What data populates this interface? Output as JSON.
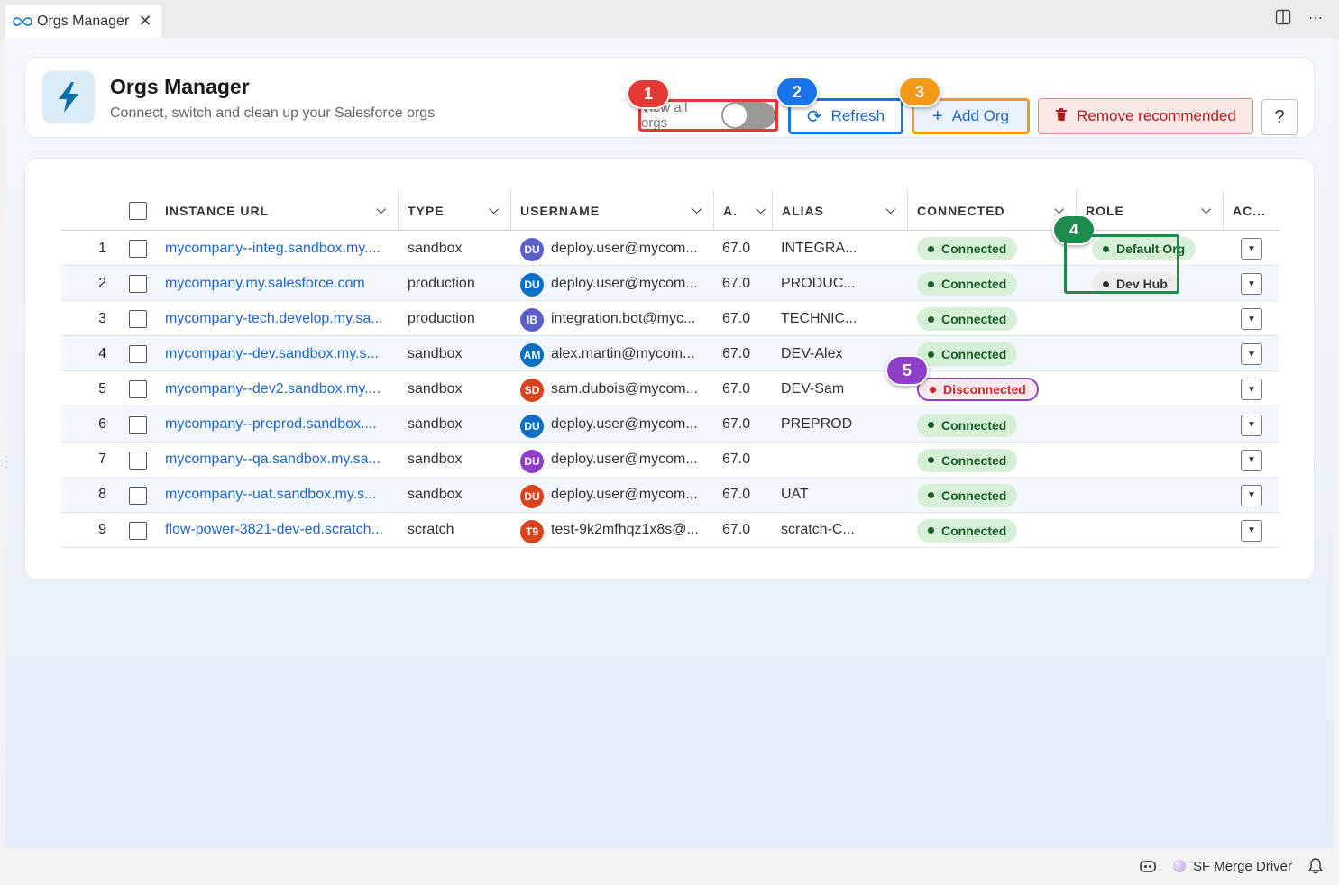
{
  "tab": {
    "title": "Orgs Manager"
  },
  "header": {
    "title": "Orgs Manager",
    "subtitle": "Connect, switch and clean up your Salesforce orgs",
    "toggle_label": "View all orgs",
    "toggle_on": false,
    "refresh_label": "Refresh",
    "add_label": "Add Org",
    "remove_label": "Remove recommended",
    "help_label": "?"
  },
  "badges": [
    "1",
    "2",
    "3",
    "4",
    "5"
  ],
  "columns": [
    "INSTANCE URL",
    "TYPE",
    "USERNAME",
    "A.",
    "ALIAS",
    "CONNECTED",
    "ROLE",
    "AC..."
  ],
  "rows": [
    {
      "num": "1",
      "url": "mycompany--integ.sandbox.my....",
      "type": "sandbox",
      "initials": "DU",
      "avatar_color": "#5b5fc7",
      "user": "deploy.user@mycom...",
      "api": "67.0",
      "alias": "INTEGRA...",
      "connected": "Connected",
      "role": "Default Org"
    },
    {
      "num": "2",
      "url": "mycompany.my.salesforce.com",
      "type": "production",
      "initials": "DU",
      "avatar_color": "#0b6fc6",
      "user": "deploy.user@mycom...",
      "api": "67.0",
      "alias": "PRODUC...",
      "connected": "Connected",
      "role": "Dev Hub"
    },
    {
      "num": "3",
      "url": "mycompany-tech.develop.my.sa...",
      "type": "production",
      "initials": "IB",
      "avatar_color": "#5b5fc7",
      "user": "integration.bot@myc...",
      "api": "67.0",
      "alias": "TECHNIC...",
      "connected": "Connected",
      "role": ""
    },
    {
      "num": "4",
      "url": "mycompany--dev.sandbox.my.s...",
      "type": "sandbox",
      "initials": "AM",
      "avatar_color": "#0b6fc6",
      "user": "alex.martin@mycom...",
      "api": "67.0",
      "alias": "DEV-Alex",
      "connected": "Connected",
      "role": ""
    },
    {
      "num": "5",
      "url": "mycompany--dev2.sandbox.my....",
      "type": "sandbox",
      "initials": "SD",
      "avatar_color": "#d9441e",
      "user": "sam.dubois@mycom...",
      "api": "67.0",
      "alias": "DEV-Sam",
      "connected": "Disconnected",
      "role": ""
    },
    {
      "num": "6",
      "url": "mycompany--preprod.sandbox....",
      "type": "sandbox",
      "initials": "DU",
      "avatar_color": "#0b6fc6",
      "user": "deploy.user@mycom...",
      "api": "67.0",
      "alias": "PREPROD",
      "connected": "Connected",
      "role": ""
    },
    {
      "num": "7",
      "url": "mycompany--qa.sandbox.my.sa...",
      "type": "sandbox",
      "initials": "DU",
      "avatar_color": "#8e3fc7",
      "user": "deploy.user@mycom...",
      "api": "67.0",
      "alias": "",
      "connected": "Connected",
      "role": ""
    },
    {
      "num": "8",
      "url": "mycompany--uat.sandbox.my.s...",
      "type": "sandbox",
      "initials": "DU",
      "avatar_color": "#d9441e",
      "user": "deploy.user@mycom...",
      "api": "67.0",
      "alias": "UAT",
      "connected": "Connected",
      "role": ""
    },
    {
      "num": "9",
      "url": "flow-power-3821-dev-ed.scratch...",
      "type": "scratch",
      "initials": "T9",
      "avatar_color": "#d9441e",
      "user": "test-9k2mfhqz1x8s@...",
      "api": "67.0",
      "alias": "scratch-C...",
      "connected": "Connected",
      "role": ""
    }
  ],
  "statusbar": {
    "extension_label": "SF Merge Driver"
  },
  "colors": {
    "accent": "#1a73e8",
    "connected_bg": "#d6f0d8",
    "disconnected": "#c62828"
  }
}
